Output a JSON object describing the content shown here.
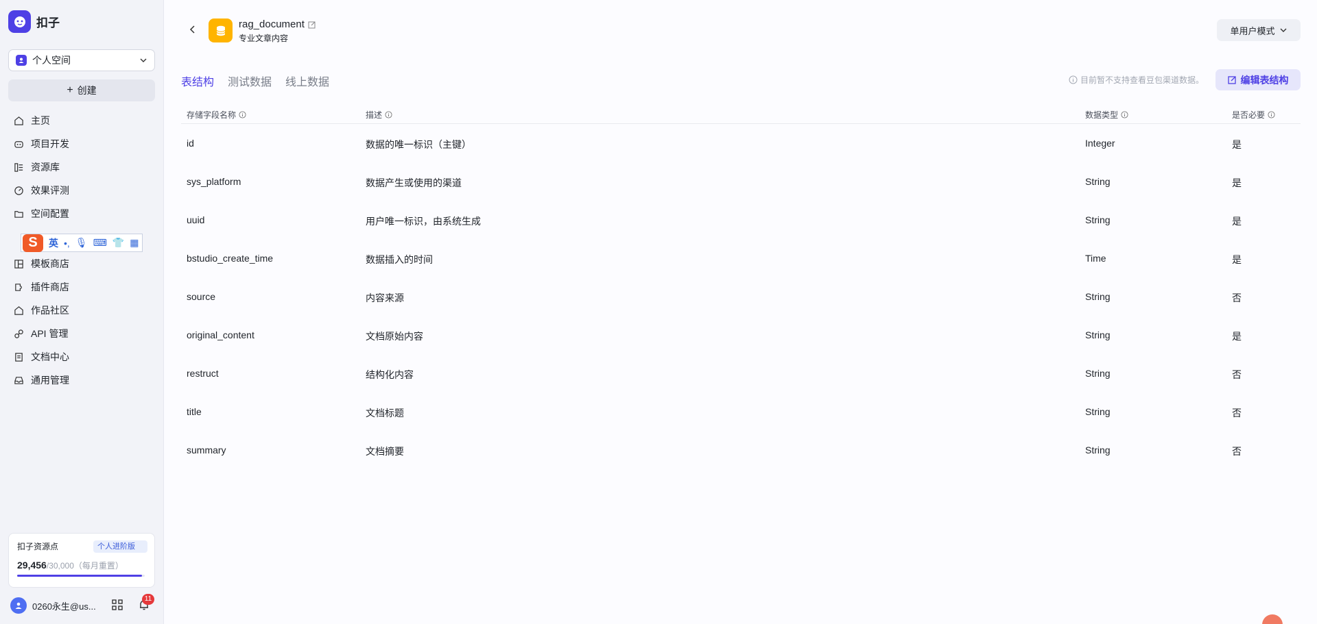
{
  "sidebar": {
    "brand": "扣子",
    "space_select": "个人空间",
    "create_label": "创建",
    "nav_top": [
      {
        "label": "主页",
        "icon": "home-icon"
      },
      {
        "label": "项目开发",
        "icon": "robot-icon"
      },
      {
        "label": "资源库",
        "icon": "library-icon"
      },
      {
        "label": "效果评测",
        "icon": "gauge-icon"
      },
      {
        "label": "空间配置",
        "icon": "folder-settings-icon"
      }
    ],
    "ime_bar": {
      "mode": "英",
      "punct": "•,"
    },
    "nav_bottom": [
      {
        "label": "模板商店",
        "icon": "template-icon"
      },
      {
        "label": "插件商店",
        "icon": "plugin-icon"
      },
      {
        "label": "作品社区",
        "icon": "community-icon"
      },
      {
        "label": "API 管理",
        "icon": "api-icon"
      },
      {
        "label": "文档中心",
        "icon": "document-icon"
      },
      {
        "label": "通用管理",
        "icon": "inbox-icon"
      }
    ],
    "points": {
      "title": "扣子资源点",
      "badge": "个人进阶版",
      "used": "29,456",
      "total": "/30,000",
      "reset_note": "（每月重置）",
      "progress_fraction": 0.98
    },
    "user": {
      "name": "0260永生@us...",
      "notification_count": "11"
    }
  },
  "header": {
    "title": "rag_document",
    "subtitle": "专业文章内容",
    "mode": "单用户模式"
  },
  "tabs": [
    {
      "label": "表结构",
      "active": true
    },
    {
      "label": "测试数据",
      "active": false
    },
    {
      "label": "线上数据",
      "active": false
    }
  ],
  "notice": "目前暂不支持查看豆包渠道数据。",
  "edit_button": "编辑表结构",
  "table": {
    "columns": [
      "存储字段名称",
      "描述",
      "数据类型",
      "是否必要"
    ],
    "rows": [
      {
        "name": "id",
        "desc": "数据的唯一标识（主键）",
        "type": "Integer",
        "required": "是"
      },
      {
        "name": "sys_platform",
        "desc": "数据产生或使用的渠道",
        "type": "String",
        "required": "是"
      },
      {
        "name": "uuid",
        "desc": "用户唯一标识，由系统生成",
        "type": "String",
        "required": "是"
      },
      {
        "name": "bstudio_create_time",
        "desc": "数据插入的时间",
        "type": "Time",
        "required": "是"
      },
      {
        "name": "source",
        "desc": "内容来源",
        "type": "String",
        "required": "否"
      },
      {
        "name": "original_content",
        "desc": "文档原始内容",
        "type": "String",
        "required": "是"
      },
      {
        "name": "restruct",
        "desc": "结构化内容",
        "type": "String",
        "required": "否"
      },
      {
        "name": "title",
        "desc": "文档标题",
        "type": "String",
        "required": "否"
      },
      {
        "name": "summary",
        "desc": "文档摘要",
        "type": "String",
        "required": "否"
      }
    ]
  }
}
